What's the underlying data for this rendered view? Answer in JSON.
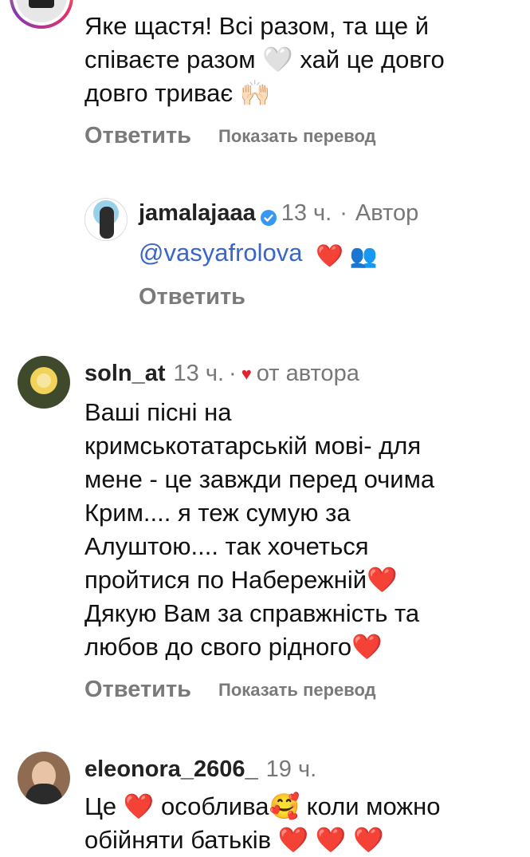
{
  "comments": [
    {
      "text_lines": [
        "Яке щастя! Всі разом, та ще й",
        "співаєте разом 🤍 хай це довго",
        "довго триває 🙌🏻"
      ],
      "reply_label": "Ответить",
      "translate_label": "Показать перевод"
    },
    {
      "username": "jamalajaaa",
      "time": "13 ч.",
      "separator": "·",
      "author_label": "Автор",
      "mention": "@vasyafrolova",
      "emojis": "❤️ 👥",
      "reply_label": "Ответить"
    },
    {
      "username": "soln_at",
      "time": "13 ч.",
      "separator": "·",
      "liked_label": "от автора",
      "text_lines": [
        "Ваші пісні на",
        "кримськотатарській мові- для",
        "мене - це завжди перед очима",
        "Крим.... я теж сумую за",
        "Алуштою.... так хочеться",
        "пройтися по Набережній❤️",
        "Дякую Вам за справжність та",
        "любов до свого рідного❤️"
      ],
      "reply_label": "Ответить",
      "translate_label": "Показать перевод"
    },
    {
      "username": "eleonora_2606_",
      "time": "19 ч.",
      "text_lines": [
        "Це ❤️ особлива🥰 коли можно",
        "обійняти батьків ❤️ ❤️ ❤️"
      ]
    }
  ],
  "colors": {
    "mention": "#3a66c8",
    "heart": "#e0242d",
    "verified": "#3897f0",
    "muted": "#7a7a7a"
  },
  "icons": [
    "verified-badge-icon",
    "liked-heart-icon"
  ]
}
